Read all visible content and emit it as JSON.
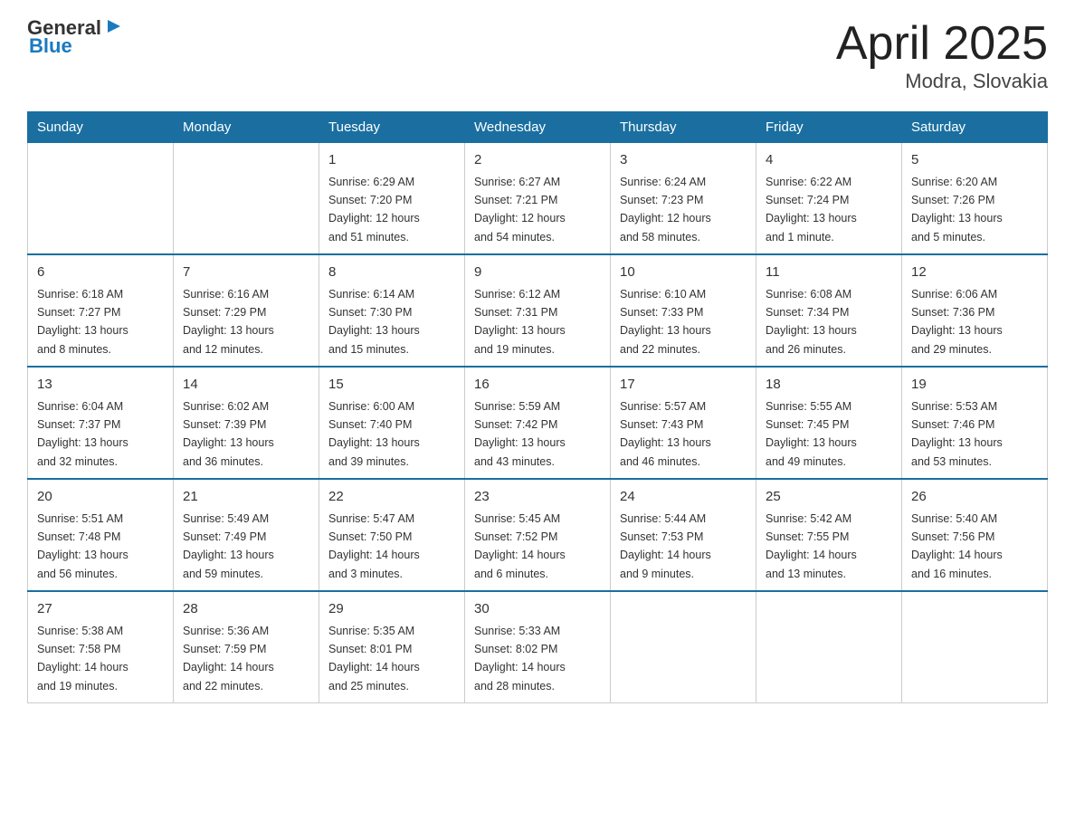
{
  "header": {
    "logo_general": "General",
    "logo_blue": "Blue",
    "title": "April 2025",
    "subtitle": "Modra, Slovakia"
  },
  "days_of_week": [
    "Sunday",
    "Monday",
    "Tuesday",
    "Wednesday",
    "Thursday",
    "Friday",
    "Saturday"
  ],
  "weeks": [
    [
      {
        "day": "",
        "info": ""
      },
      {
        "day": "",
        "info": ""
      },
      {
        "day": "1",
        "info": "Sunrise: 6:29 AM\nSunset: 7:20 PM\nDaylight: 12 hours\nand 51 minutes."
      },
      {
        "day": "2",
        "info": "Sunrise: 6:27 AM\nSunset: 7:21 PM\nDaylight: 12 hours\nand 54 minutes."
      },
      {
        "day": "3",
        "info": "Sunrise: 6:24 AM\nSunset: 7:23 PM\nDaylight: 12 hours\nand 58 minutes."
      },
      {
        "day": "4",
        "info": "Sunrise: 6:22 AM\nSunset: 7:24 PM\nDaylight: 13 hours\nand 1 minute."
      },
      {
        "day": "5",
        "info": "Sunrise: 6:20 AM\nSunset: 7:26 PM\nDaylight: 13 hours\nand 5 minutes."
      }
    ],
    [
      {
        "day": "6",
        "info": "Sunrise: 6:18 AM\nSunset: 7:27 PM\nDaylight: 13 hours\nand 8 minutes."
      },
      {
        "day": "7",
        "info": "Sunrise: 6:16 AM\nSunset: 7:29 PM\nDaylight: 13 hours\nand 12 minutes."
      },
      {
        "day": "8",
        "info": "Sunrise: 6:14 AM\nSunset: 7:30 PM\nDaylight: 13 hours\nand 15 minutes."
      },
      {
        "day": "9",
        "info": "Sunrise: 6:12 AM\nSunset: 7:31 PM\nDaylight: 13 hours\nand 19 minutes."
      },
      {
        "day": "10",
        "info": "Sunrise: 6:10 AM\nSunset: 7:33 PM\nDaylight: 13 hours\nand 22 minutes."
      },
      {
        "day": "11",
        "info": "Sunrise: 6:08 AM\nSunset: 7:34 PM\nDaylight: 13 hours\nand 26 minutes."
      },
      {
        "day": "12",
        "info": "Sunrise: 6:06 AM\nSunset: 7:36 PM\nDaylight: 13 hours\nand 29 minutes."
      }
    ],
    [
      {
        "day": "13",
        "info": "Sunrise: 6:04 AM\nSunset: 7:37 PM\nDaylight: 13 hours\nand 32 minutes."
      },
      {
        "day": "14",
        "info": "Sunrise: 6:02 AM\nSunset: 7:39 PM\nDaylight: 13 hours\nand 36 minutes."
      },
      {
        "day": "15",
        "info": "Sunrise: 6:00 AM\nSunset: 7:40 PM\nDaylight: 13 hours\nand 39 minutes."
      },
      {
        "day": "16",
        "info": "Sunrise: 5:59 AM\nSunset: 7:42 PM\nDaylight: 13 hours\nand 43 minutes."
      },
      {
        "day": "17",
        "info": "Sunrise: 5:57 AM\nSunset: 7:43 PM\nDaylight: 13 hours\nand 46 minutes."
      },
      {
        "day": "18",
        "info": "Sunrise: 5:55 AM\nSunset: 7:45 PM\nDaylight: 13 hours\nand 49 minutes."
      },
      {
        "day": "19",
        "info": "Sunrise: 5:53 AM\nSunset: 7:46 PM\nDaylight: 13 hours\nand 53 minutes."
      }
    ],
    [
      {
        "day": "20",
        "info": "Sunrise: 5:51 AM\nSunset: 7:48 PM\nDaylight: 13 hours\nand 56 minutes."
      },
      {
        "day": "21",
        "info": "Sunrise: 5:49 AM\nSunset: 7:49 PM\nDaylight: 13 hours\nand 59 minutes."
      },
      {
        "day": "22",
        "info": "Sunrise: 5:47 AM\nSunset: 7:50 PM\nDaylight: 14 hours\nand 3 minutes."
      },
      {
        "day": "23",
        "info": "Sunrise: 5:45 AM\nSunset: 7:52 PM\nDaylight: 14 hours\nand 6 minutes."
      },
      {
        "day": "24",
        "info": "Sunrise: 5:44 AM\nSunset: 7:53 PM\nDaylight: 14 hours\nand 9 minutes."
      },
      {
        "day": "25",
        "info": "Sunrise: 5:42 AM\nSunset: 7:55 PM\nDaylight: 14 hours\nand 13 minutes."
      },
      {
        "day": "26",
        "info": "Sunrise: 5:40 AM\nSunset: 7:56 PM\nDaylight: 14 hours\nand 16 minutes."
      }
    ],
    [
      {
        "day": "27",
        "info": "Sunrise: 5:38 AM\nSunset: 7:58 PM\nDaylight: 14 hours\nand 19 minutes."
      },
      {
        "day": "28",
        "info": "Sunrise: 5:36 AM\nSunset: 7:59 PM\nDaylight: 14 hours\nand 22 minutes."
      },
      {
        "day": "29",
        "info": "Sunrise: 5:35 AM\nSunset: 8:01 PM\nDaylight: 14 hours\nand 25 minutes."
      },
      {
        "day": "30",
        "info": "Sunrise: 5:33 AM\nSunset: 8:02 PM\nDaylight: 14 hours\nand 28 minutes."
      },
      {
        "day": "",
        "info": ""
      },
      {
        "day": "",
        "info": ""
      },
      {
        "day": "",
        "info": ""
      }
    ]
  ]
}
